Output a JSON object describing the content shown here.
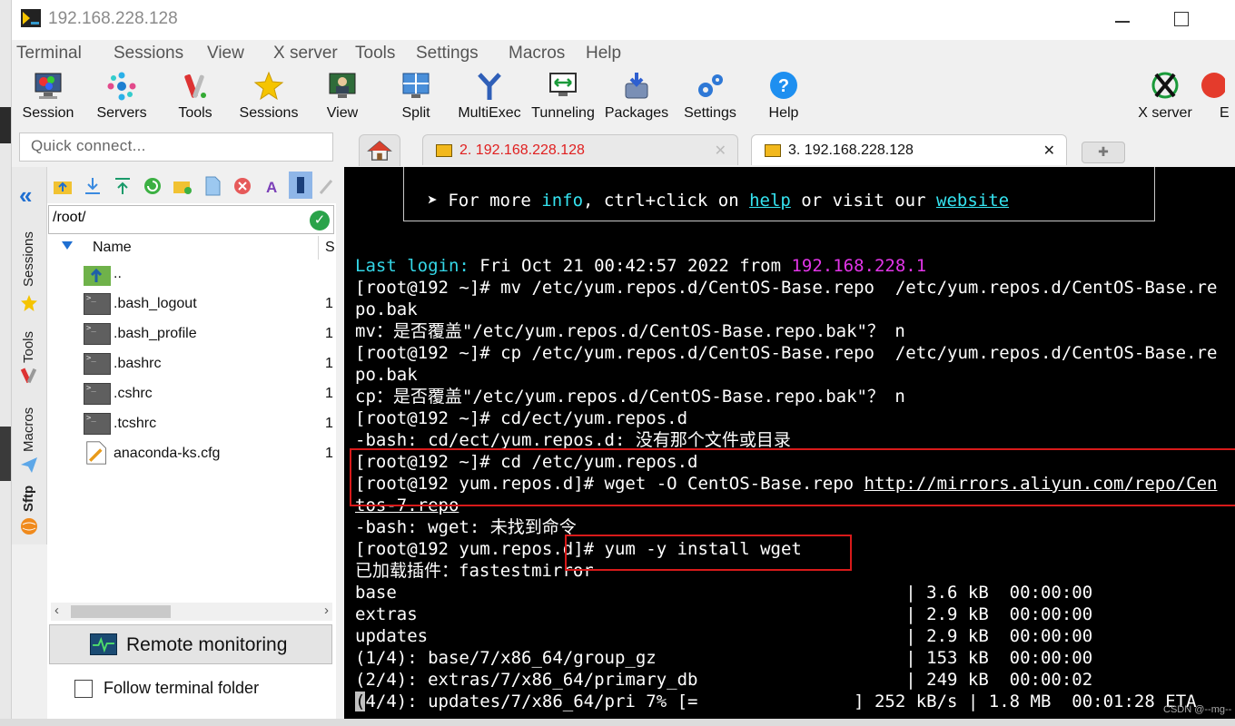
{
  "window": {
    "title": "192.168.228.128"
  },
  "menu": [
    "Terminal",
    "Sessions",
    "View",
    "X server",
    "Tools",
    "Settings",
    "Macros",
    "Help"
  ],
  "toolbar": [
    {
      "label": "Session",
      "icon": "session-icon"
    },
    {
      "label": "Servers",
      "icon": "servers-icon"
    },
    {
      "label": "Tools",
      "icon": "tools-icon"
    },
    {
      "label": "Sessions",
      "icon": "star-icon"
    },
    {
      "label": "View",
      "icon": "view-icon"
    },
    {
      "label": "Split",
      "icon": "split-icon"
    },
    {
      "label": "MultiExec",
      "icon": "multiexec-icon"
    },
    {
      "label": "Tunneling",
      "icon": "tunneling-icon"
    },
    {
      "label": "Packages",
      "icon": "packages-icon"
    },
    {
      "label": "Settings",
      "icon": "settings-icon"
    },
    {
      "label": "Help",
      "icon": "help-icon"
    }
  ],
  "toolbar_right": [
    {
      "label": "X server",
      "icon": "x-server-icon"
    },
    {
      "label": "E",
      "icon": "exit-icon"
    }
  ],
  "quick_connect": {
    "placeholder": "Quick connect..."
  },
  "tabs": [
    {
      "label": "2. 192.168.228.128",
      "close": "✕",
      "color": "#e02020"
    },
    {
      "label": "3. 192.168.228.128",
      "close": "✕",
      "color": "#111111"
    }
  ],
  "sidebar_tabs": [
    "Sessions",
    "Tools",
    "Macros",
    "Sftp"
  ],
  "file_panel": {
    "path": "/root/",
    "header_name": "Name",
    "header_size": "S",
    "files": [
      {
        "name": "..",
        "size": ""
      },
      {
        "name": ".bash_logout",
        "size": "1"
      },
      {
        "name": ".bash_profile",
        "size": "1"
      },
      {
        "name": ".bashrc",
        "size": "1"
      },
      {
        "name": ".cshrc",
        "size": "1"
      },
      {
        "name": ".tcshrc",
        "size": "1"
      },
      {
        "name": "anaconda-ks.cfg",
        "size": "1"
      }
    ],
    "remote_monitoring": "Remote monitoring",
    "follow_folder": "Follow terminal folder"
  },
  "terminal": {
    "banner": {
      "prefix": " ➤ For more ",
      "info": "info",
      "mid": ", ctrl+click on ",
      "help": "help",
      "or": " or visit our ",
      "website": "website"
    },
    "last_login_label": "Last login:",
    "last_login_text": " Fri Oct 21 00:42:57 2022 from ",
    "last_login_ip": "192.168.228.1",
    "lines": [
      "[root@192 ~]# mv /etc/yum.repos.d/CentOS-Base.repo  /etc/yum.repos.d/CentOS-Base.re",
      "po.bak",
      "mv：是否覆盖\"/etc/yum.repos.d/CentOS-Base.repo.bak\"？ n",
      "[root@192 ~]# cp /etc/yum.repos.d/CentOS-Base.repo  /etc/yum.repos.d/CentOS-Base.re",
      "po.bak",
      "cp：是否覆盖\"/etc/yum.repos.d/CentOS-Base.repo.bak\"？ n",
      "[root@192 ~]# cd/ect/yum.repos.d",
      "-bash: cd/ect/yum.repos.d: 没有那个文件或目录",
      "[root@192 ~]# cd /etc/yum.repos.d"
    ],
    "wget_prefix": "[root@192 yum.repos.d]# wget -O CentOS-Base.repo ",
    "wget_url": "http://mirrors.aliyun.com/repo/Cen",
    "wget_url_cont": "tos-7.repo",
    "lines2": [
      "-bash: wget: 未找到命令",
      "[root@192 yum.repos.d]# yum -y install wget",
      "已加载插件：fastestmirror",
      "base                                                 | 3.6 kB  00:00:00",
      "extras                                               | 2.9 kB  00:00:00",
      "updates                                              | 2.9 kB  00:00:00",
      "(1/4): base/7/x86_64/group_gz                        | 153 kB  00:00:00",
      "(2/4): extras/7/x86_64/primary_db                    | 249 kB  00:00:02"
    ],
    "progress_line": "4/4): updates/7/x86_64/pri 7% [=               ] 252 kB/s | 1.8 MB  00:01:28 ETA",
    "progress_cursor": "("
  },
  "watermark": "CSDN @--mg--",
  "colors": {
    "accent": "#1f6fd1",
    "highlight_box": "#d81a1a",
    "terminal_cyan": "#35e3f0",
    "terminal_magenta": "#e235e8"
  }
}
